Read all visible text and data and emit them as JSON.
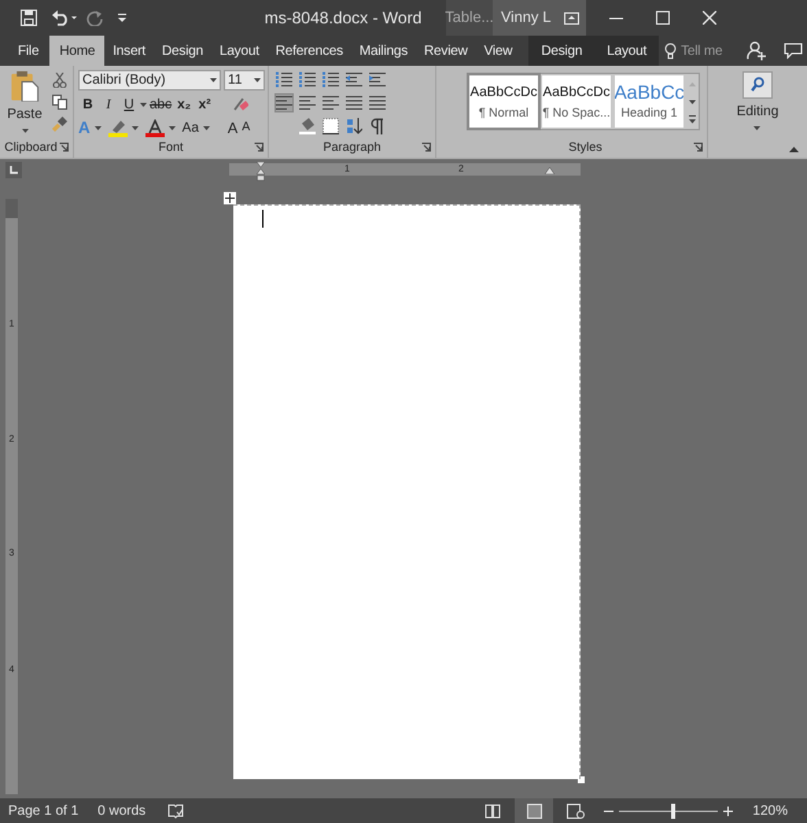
{
  "window": {
    "title": "ms-8048.docx - Word",
    "contextual_label": "Table...",
    "user": "Vinny L"
  },
  "tabs": [
    {
      "label": "File",
      "selected": false,
      "kind": "main"
    },
    {
      "label": "Home",
      "selected": true,
      "kind": "main"
    },
    {
      "label": "Insert",
      "selected": false,
      "kind": "main"
    },
    {
      "label": "Design",
      "selected": false,
      "kind": "main"
    },
    {
      "label": "Layout",
      "selected": false,
      "kind": "main"
    },
    {
      "label": "References",
      "selected": false,
      "kind": "main"
    },
    {
      "label": "Mailings",
      "selected": false,
      "kind": "main"
    },
    {
      "label": "Review",
      "selected": false,
      "kind": "main"
    },
    {
      "label": "View",
      "selected": false,
      "kind": "main"
    },
    {
      "label": "Design",
      "selected": false,
      "kind": "contextual"
    },
    {
      "label": "Layout",
      "selected": false,
      "kind": "contextual"
    }
  ],
  "tell_me": {
    "placeholder": "Tell me"
  },
  "ribbon": {
    "clipboard": {
      "paste": "Paste",
      "label": "Clipboard"
    },
    "font": {
      "font_name": "Calibri (Body)",
      "font_size": "11",
      "row1": [
        "B",
        "I",
        "U",
        "abc",
        "x₂",
        "x²"
      ],
      "row3": [
        "A",
        "Aa",
        "A",
        "A"
      ],
      "label": "Font"
    },
    "paragraph": {
      "label": "Paragraph"
    },
    "styles": {
      "items": [
        {
          "preview": "AaBbCcDc",
          "name": "¶ Normal",
          "selected": true,
          "kind": "body"
        },
        {
          "preview": "AaBbCcDc",
          "name": "¶ No Spac...",
          "selected": false,
          "kind": "body"
        },
        {
          "preview": "AaBbCc",
          "name": "Heading 1",
          "selected": false,
          "kind": "heading"
        }
      ],
      "label": "Styles"
    },
    "editing": {
      "label": "Editing"
    }
  },
  "horizontal_ruler": [
    "1",
    "2"
  ],
  "vertical_ruler": [
    "1",
    "2",
    "3",
    "4"
  ],
  "status_bar": {
    "page": "Page 1 of 1",
    "words": "0 words",
    "zoom": "120%",
    "zoom_slider": {
      "level": 0.54
    }
  }
}
